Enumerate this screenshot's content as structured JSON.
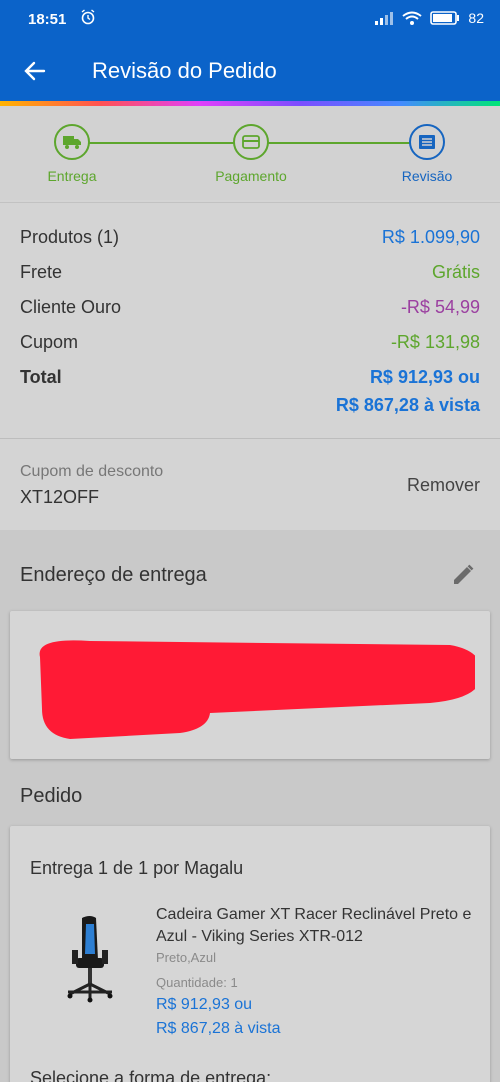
{
  "status_bar": {
    "time": "18:51",
    "battery": "82"
  },
  "app_bar": {
    "title": "Revisão do Pedido"
  },
  "stepper": {
    "steps": [
      {
        "label": "Entrega",
        "icon": "truck-icon",
        "state": "done"
      },
      {
        "label": "Pagamento",
        "icon": "card-icon",
        "state": "done"
      },
      {
        "label": "Revisão",
        "icon": "list-icon",
        "state": "current"
      }
    ]
  },
  "summary": {
    "products_label": "Produtos (1)",
    "products_value": "R$ 1.099,90",
    "shipping_label": "Frete",
    "shipping_value": "Grátis",
    "gold_label": "Cliente Ouro",
    "gold_value": "-R$ 54,99",
    "coupon_label": "Cupom",
    "coupon_value": "-R$ 131,98",
    "total_label": "Total",
    "total_value_1": "R$ 912,93 ou",
    "total_value_2": "R$ 867,28 à vista"
  },
  "coupon": {
    "label": "Cupom de desconto",
    "code": "XT12OFF",
    "remove": "Remover"
  },
  "address": {
    "title": "Endereço de entrega"
  },
  "order": {
    "title": "Pedido",
    "delivery": "Entrega 1 de 1 por Magalu",
    "product_name": "Cadeira Gamer XT Racer Reclinável Preto e Azul - Viking Series XTR-012",
    "variant": "Preto,Azul",
    "quantity": "Quantidade:  1",
    "price_1": "R$ 912,93 ou",
    "price_2": "R$ 867,28 à vista",
    "select_delivery": "Selecione a forma de entrega:"
  },
  "colors": {
    "primary": "#0b63c9",
    "price_blue": "#1a73d6",
    "green": "#5da62d",
    "purple": "#9b3fa0"
  }
}
